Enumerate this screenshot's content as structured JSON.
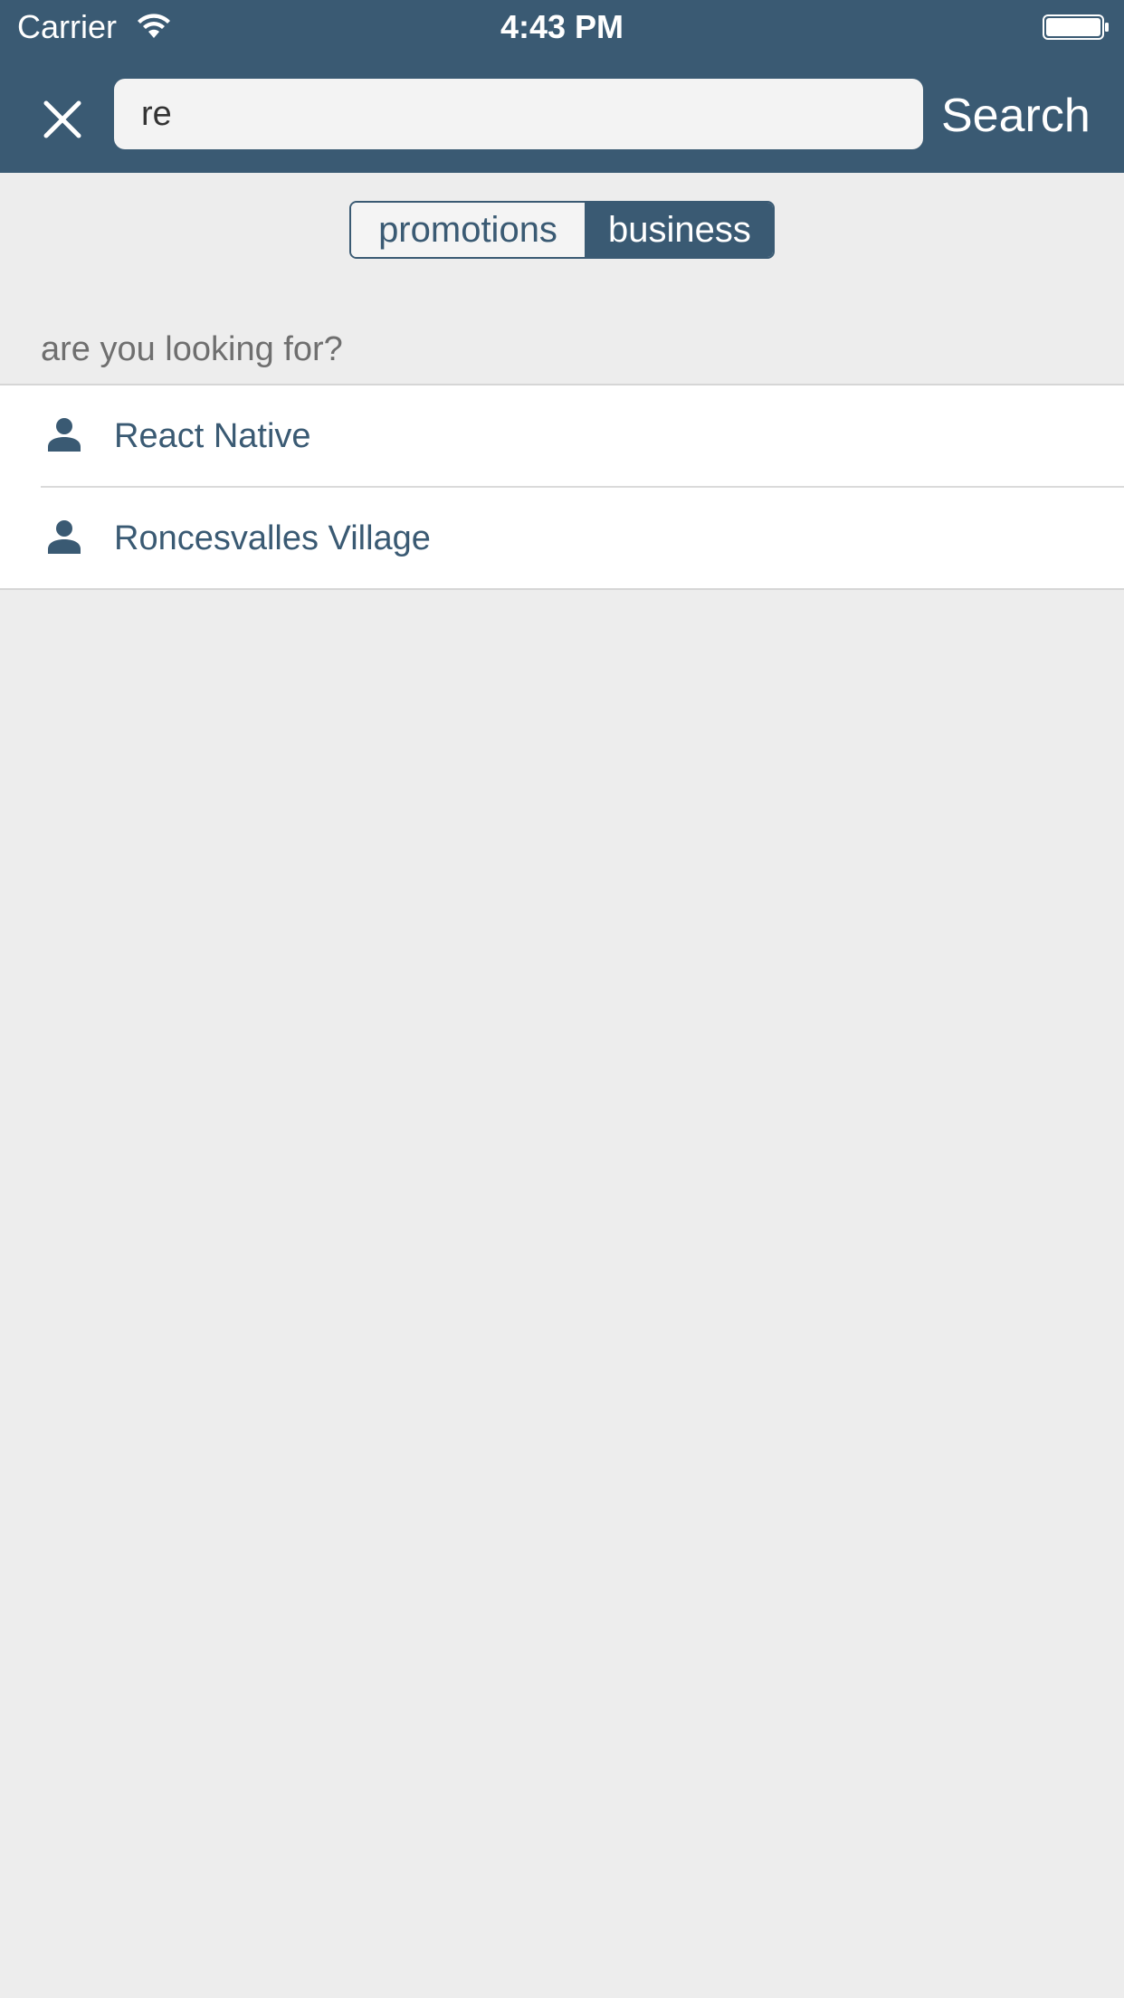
{
  "status_bar": {
    "carrier": "Carrier",
    "time": "4:43 PM",
    "wifi_icon": "wifi-icon",
    "battery_icon": "battery-icon"
  },
  "search_bar": {
    "close_icon": "close-icon",
    "query": "re",
    "search_label": "Search"
  },
  "segments": {
    "items": [
      {
        "label": "promotions",
        "selected": false
      },
      {
        "label": "business",
        "selected": true
      }
    ]
  },
  "section": {
    "title": "are you looking for?"
  },
  "results": [
    {
      "label": "React Native",
      "icon": "person-icon"
    },
    {
      "label": "Roncesvalles Village",
      "icon": "person-icon"
    }
  ],
  "colors": {
    "brand": "#3a5a73",
    "background": "#ededed",
    "white": "#ffffff"
  }
}
